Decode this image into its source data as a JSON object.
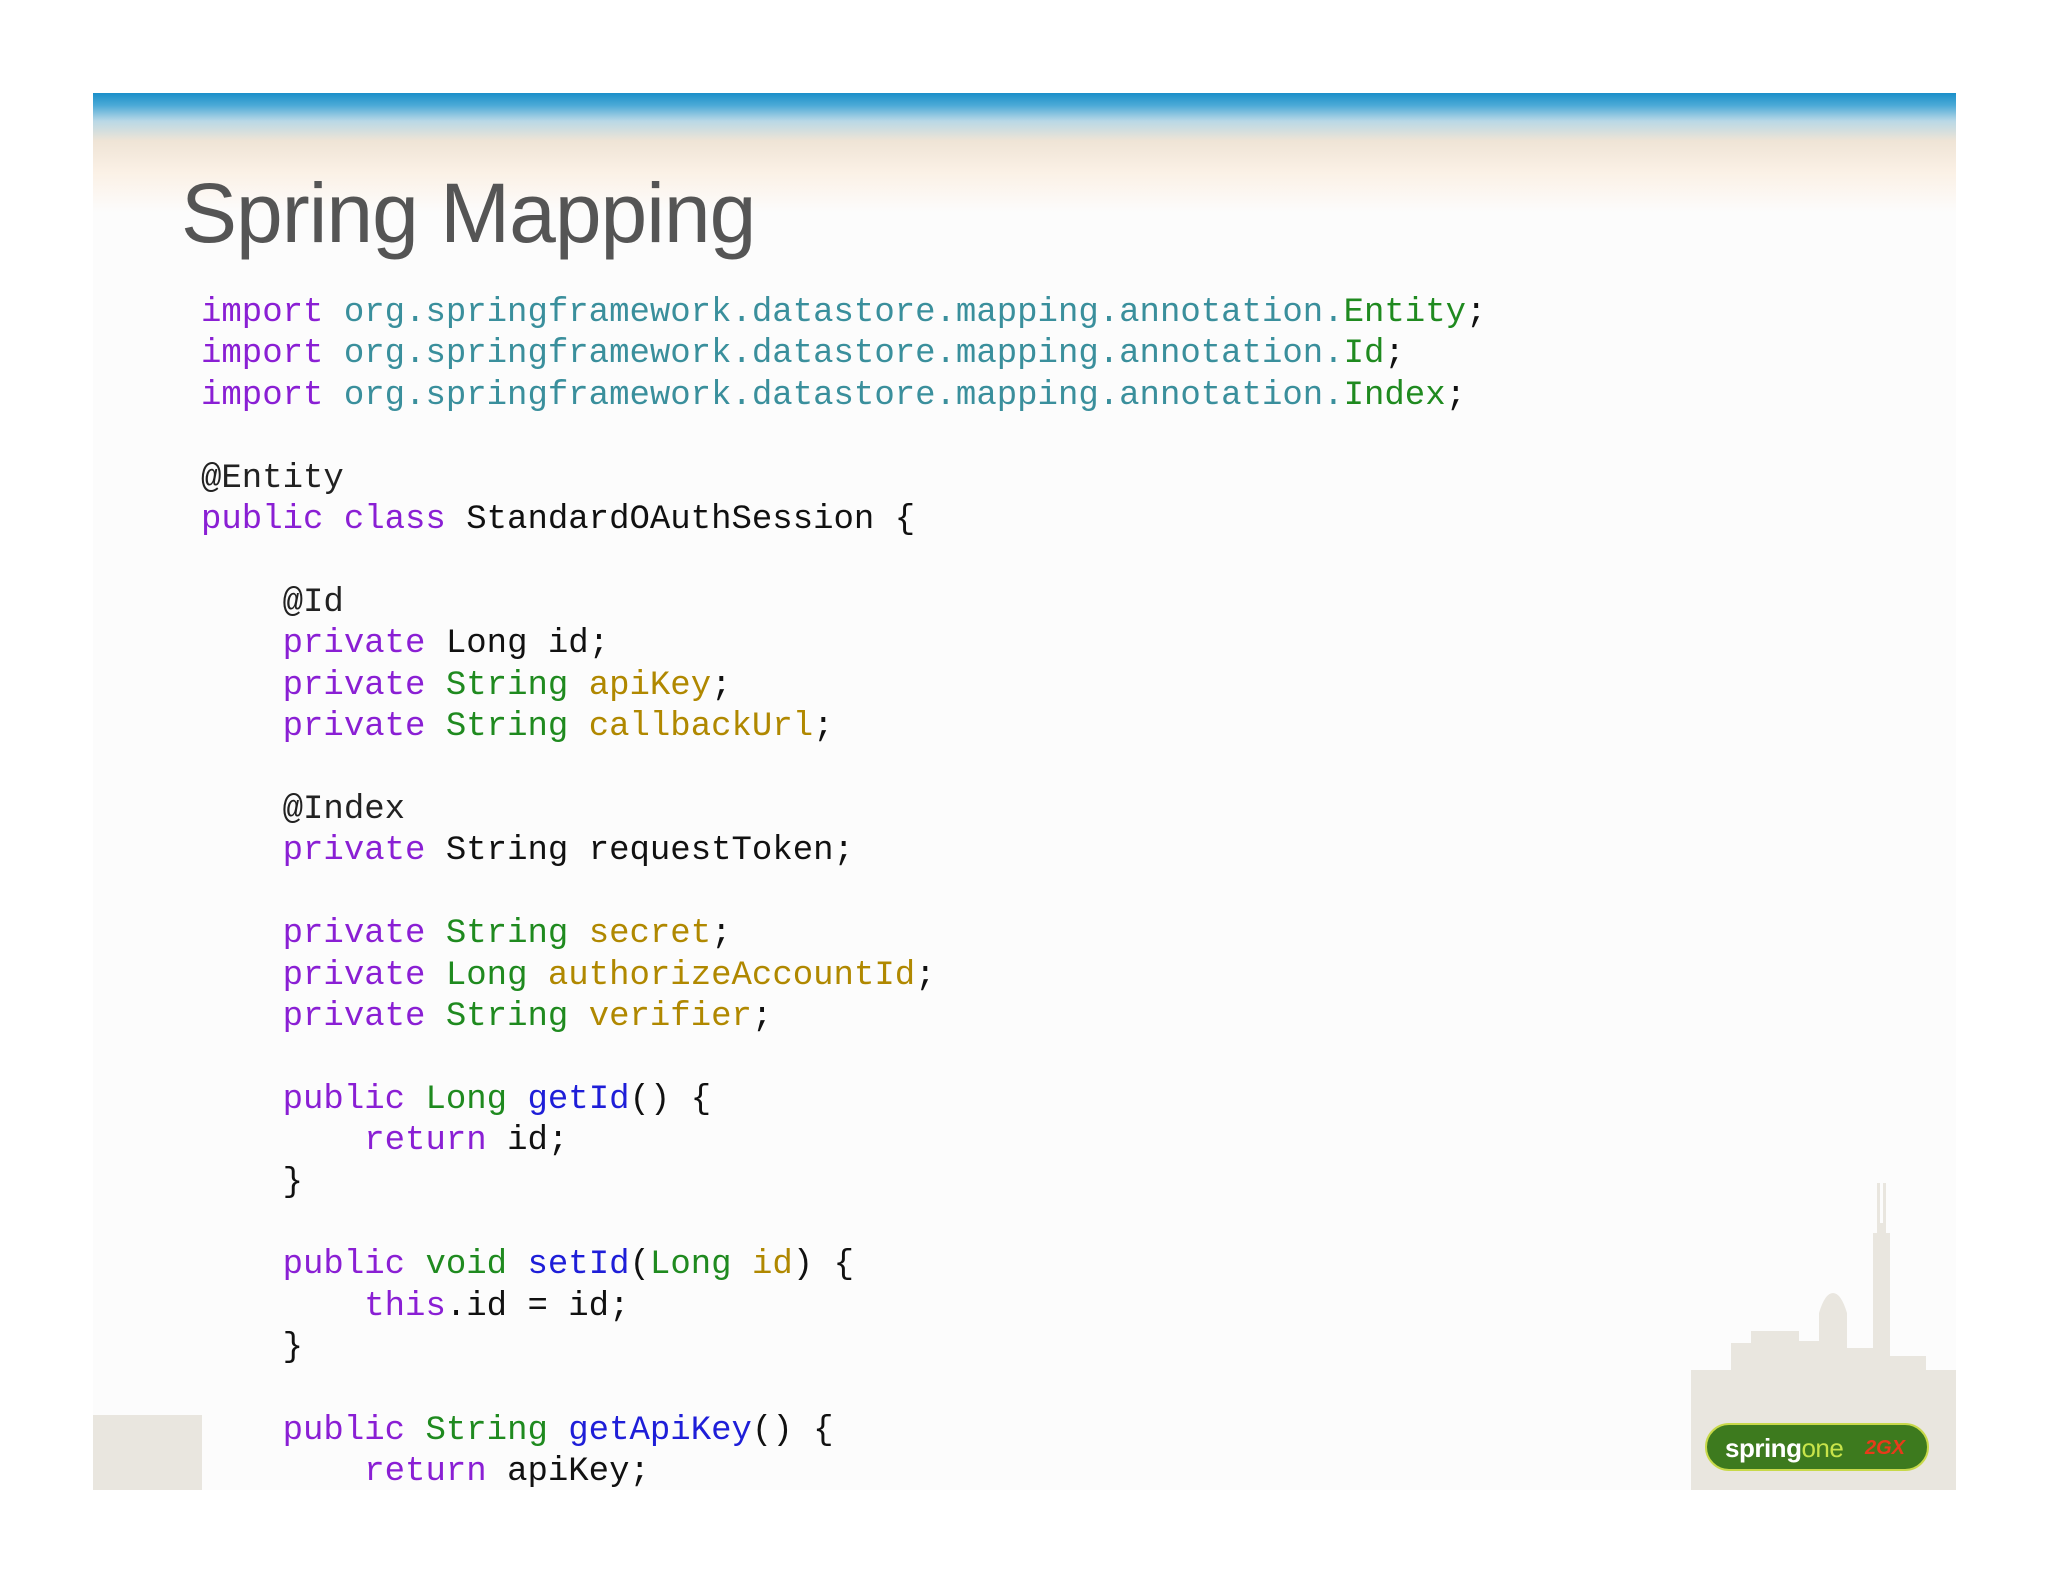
{
  "slide": {
    "title": "Spring Mapping"
  },
  "code": {
    "imports": [
      {
        "kw": "import",
        "pkg": "org.springframework.datastore.mapping.annotation.",
        "cls": "Entity",
        "end": ";"
      },
      {
        "kw": "import",
        "pkg": "org.springframework.datastore.mapping.annotation.",
        "cls": "Id",
        "end": ";"
      },
      {
        "kw": "import",
        "pkg": "org.springframework.datastore.mapping.annotation.",
        "cls": "Index",
        "end": ";"
      }
    ],
    "entity_annotation": "@Entity",
    "class_modifiers": "public class",
    "class_name": "StandardOAuthSession {",
    "id_annotation": "@Id",
    "field_id": {
      "mod": "private",
      "type": "Long",
      "name": "id;"
    },
    "field_apikey": {
      "mod": "private",
      "type": "String",
      "name": "apiKey",
      "end": ";"
    },
    "field_callback": {
      "mod": "private",
      "type": "String",
      "name": "callbackUrl",
      "end": ";"
    },
    "index_annotation": "@Index",
    "field_reqtoken": {
      "mod": "private",
      "type": "String",
      "name": "requestToken;"
    },
    "field_secret": {
      "mod": "private",
      "type": "String",
      "name": "secret",
      "end": ";"
    },
    "field_authacc": {
      "mod": "private",
      "type": "Long",
      "name": "authorizeAccountId",
      "end": ";"
    },
    "field_verifier": {
      "mod": "private",
      "type": "String",
      "name": "verifier",
      "end": ";"
    },
    "getid": {
      "mod": "public",
      "type": "Long",
      "name": "getId",
      "rest": "() {"
    },
    "getid_body": {
      "kw": "return",
      "rest": "id;"
    },
    "close_brace": "}",
    "setid": {
      "mod": "public",
      "type": "void",
      "name": "setId",
      "paren_open": "(",
      "ptype": "Long",
      "pname": "id",
      "rest": ") {"
    },
    "setid_body": {
      "kw": "this",
      "rest": ".id = id;"
    },
    "getapikey": {
      "mod": "public",
      "type": "String",
      "name": "getApiKey",
      "rest": "() {"
    },
    "getapikey_body": {
      "kw": "return",
      "rest": "apiKey;"
    }
  },
  "logo": {
    "spring": "spring",
    "one": "one",
    "badge": "2GX"
  },
  "colors": {
    "keyword": "#8a1fd4",
    "package": "#3a8f9c",
    "class": "#1f8a1f",
    "field": "#b08800",
    "method": "#1e1ed8",
    "header_blue": "#1a8fc9",
    "logo_green": "#3d7a1e",
    "skyline": "#e9e6df"
  }
}
